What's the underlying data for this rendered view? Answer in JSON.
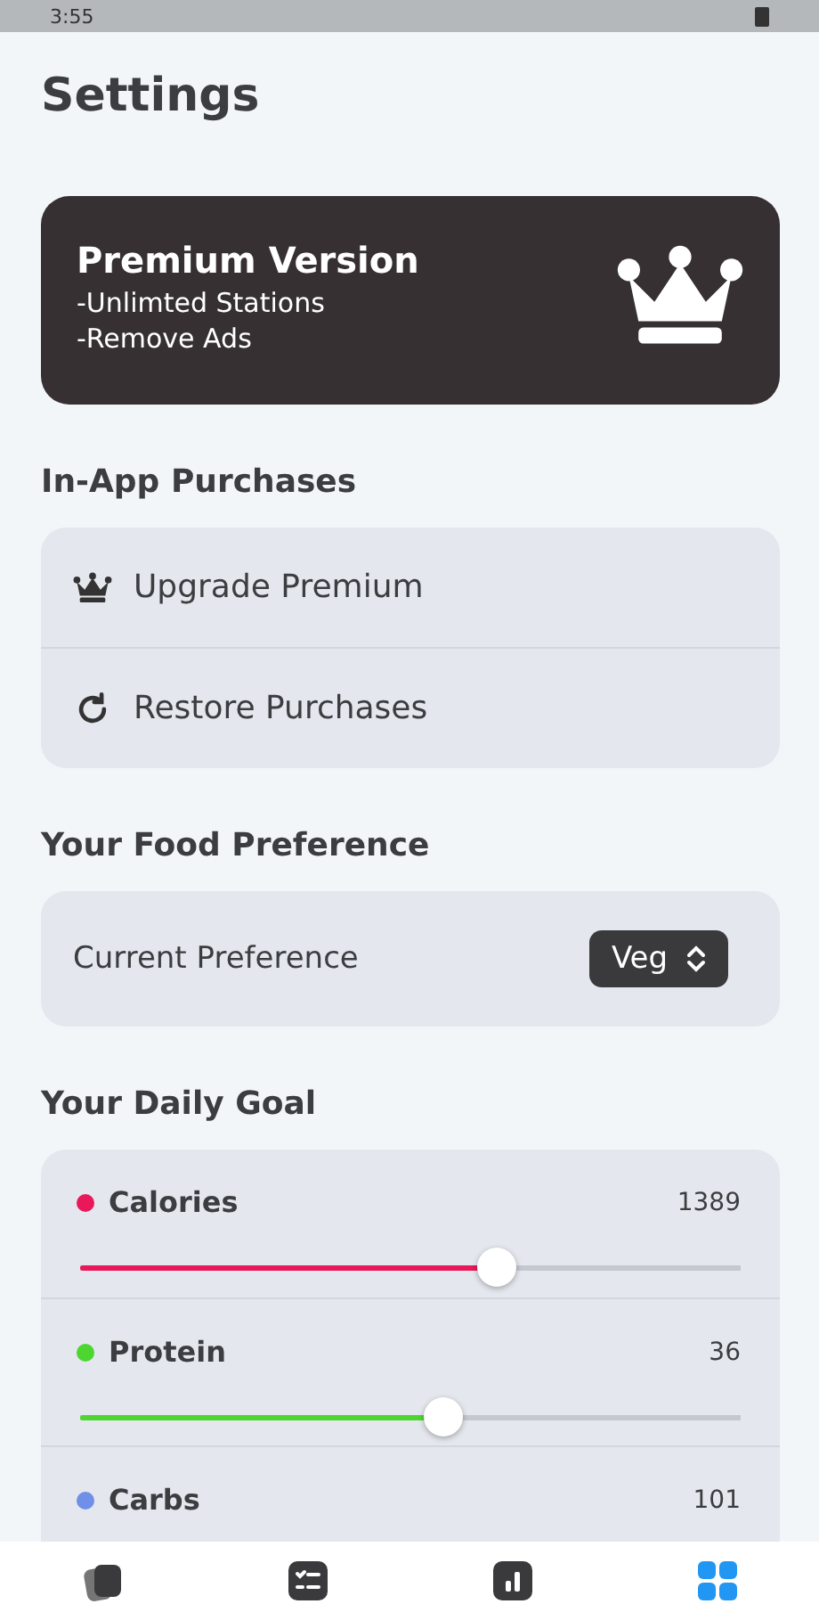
{
  "status_bar": {
    "time": "3:55"
  },
  "title": "Settings",
  "premium": {
    "title": "Premium Version",
    "features": [
      "-Unlimted Stations",
      "-Remove Ads"
    ]
  },
  "purchases": {
    "heading": "In-App Purchases",
    "items": [
      {
        "label": "Upgrade Premium",
        "kind": "crown"
      },
      {
        "label": "Restore Purchases",
        "kind": "refresh"
      }
    ]
  },
  "food": {
    "heading": "Your Food Preference",
    "label": "Current Preference",
    "value": "Veg"
  },
  "goals": {
    "heading": "Your Daily Goal",
    "items": [
      {
        "name": "Calories",
        "value": "1389",
        "color": "#e8185a",
        "level": 0.63
      },
      {
        "name": "Protein",
        "value": "36",
        "color": "#4cd62f",
        "level": 0.55
      },
      {
        "name": "Carbs",
        "value": "101",
        "color": "#6f8fe8"
      }
    ]
  },
  "nav": {
    "tabs": [
      {
        "kind": "cards",
        "selected": false
      },
      {
        "kind": "checklist",
        "selected": false
      },
      {
        "kind": "chart",
        "selected": false
      },
      {
        "kind": "grid",
        "selected": true
      }
    ]
  }
}
